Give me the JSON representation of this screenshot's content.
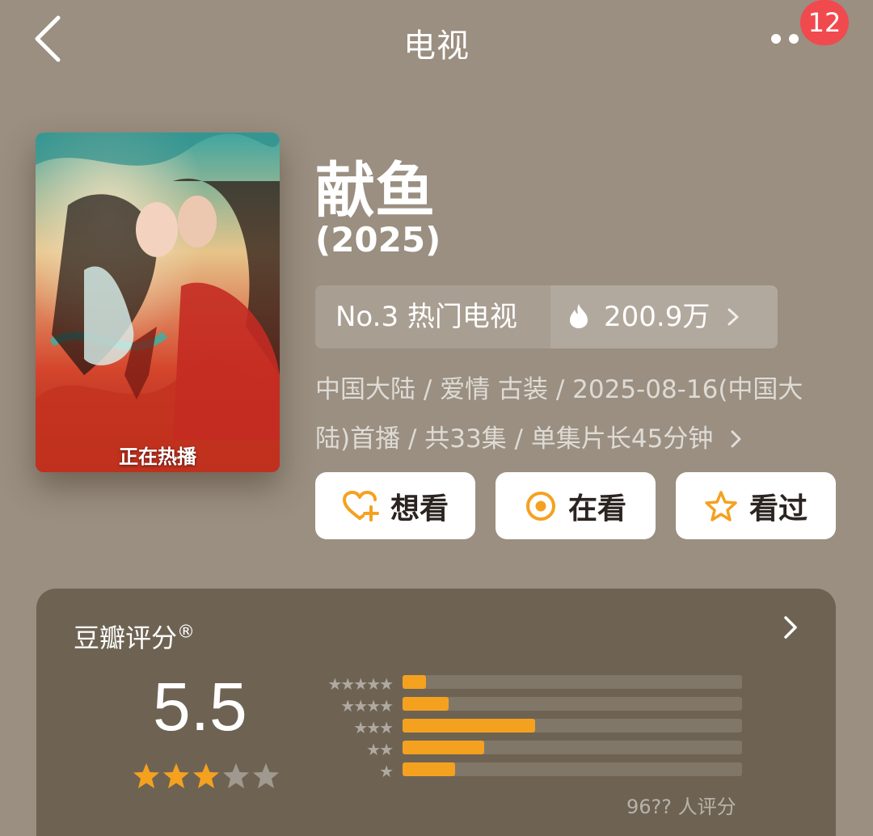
{
  "header": {
    "title": "电视",
    "badge": "12"
  },
  "poster": {
    "tag": "正在热播"
  },
  "movie": {
    "title": "献鱼",
    "year": "(2025)",
    "rank": "No.3 热门电视",
    "heat": "200.9万",
    "meta_line1": "中国大陆 / 爱情 古装 / 2025-08-16(中国大",
    "meta_line2": "陆)首播 / 共33集 / 单集片长45分钟"
  },
  "actions": {
    "want": "想看",
    "watching": "在看",
    "watched": "看过"
  },
  "rating": {
    "label": "豆瓣评分",
    "reg": "®",
    "score": "5.5",
    "stars_filled": 3,
    "stars_total": 5,
    "distribution": [
      {
        "stars": "★★★★★",
        "fraction": 0.07
      },
      {
        "stars": "★★★★",
        "fraction": 0.135
      },
      {
        "stars": "★★★",
        "fraction": 0.39
      },
      {
        "stars": "★★",
        "fraction": 0.24
      },
      {
        "stars": "★",
        "fraction": 0.155
      }
    ],
    "count": "96?? 人评分"
  },
  "colors": {
    "accent": "#f5a120",
    "badge": "#f04a4f",
    "background": "#9a8f80",
    "card": "#6e6353"
  }
}
